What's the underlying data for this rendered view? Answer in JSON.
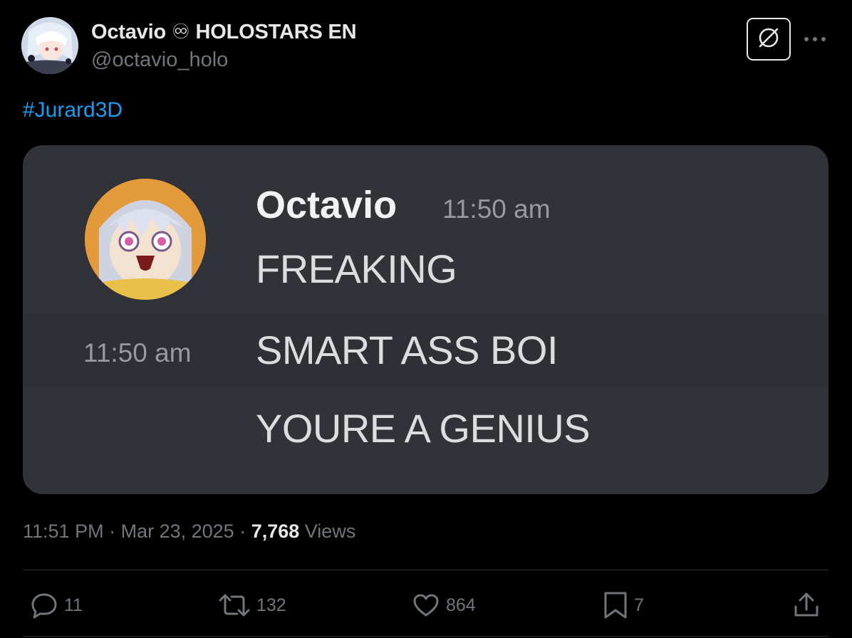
{
  "author": {
    "display_name": "Octavio ♾ HOLOSTARS EN",
    "handle": "@octavio_holo"
  },
  "tweet": {
    "hashtag": "#Jurard3D"
  },
  "media": {
    "discord_message": {
      "username": "Octavio",
      "header_time": "11:50 am",
      "side_time": "11:50 am",
      "lines": [
        "FREAKING",
        "SMART ASS BOI",
        "YOURE A GENIUS"
      ]
    }
  },
  "meta": {
    "time": "11:51 PM",
    "separator": " · ",
    "date": "Mar 23, 2025",
    "views_count": "7,768",
    "views_label": "Views"
  },
  "actions": {
    "replies": "11",
    "retweets": "132",
    "likes": "864",
    "bookmarks": "7"
  },
  "colors": {
    "background": "#000000",
    "link": "#1d9bf0",
    "muted": "#71767b",
    "discord_bg": "#313338"
  },
  "icons": [
    "grok-icon",
    "more-icon",
    "reply-icon",
    "retweet-icon",
    "like-icon",
    "bookmark-icon",
    "share-icon"
  ]
}
